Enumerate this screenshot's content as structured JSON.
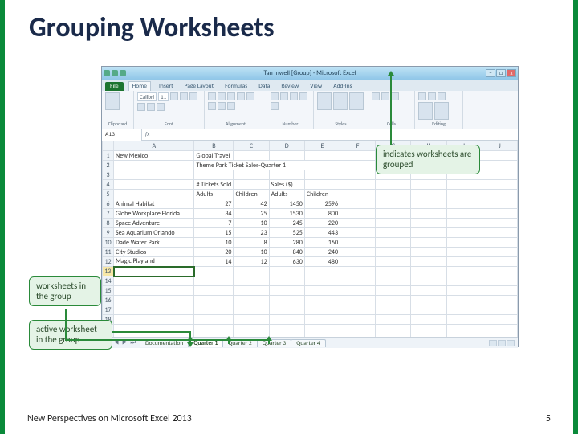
{
  "slide": {
    "title": "Grouping Worksheets",
    "footer_left": "New Perspectives on Microsoft Excel 2013",
    "footer_right": "5"
  },
  "callouts": {
    "grouped": "indicates worksheets are grouped",
    "in_group": "worksheets in the group",
    "active": "active worksheet in the group"
  },
  "excel": {
    "titlebar": "Tan Inwell [Group] - Microsoft Excel",
    "win_min": "–",
    "win_max": "□",
    "win_close": "x",
    "file_tab": "File",
    "tabs": [
      "Home",
      "Insert",
      "Page Layout",
      "Formulas",
      "Data",
      "Review",
      "View",
      "Add-Ins"
    ],
    "ribbon_groups": [
      "Clipboard",
      "Font",
      "Alignment",
      "Number",
      "Styles",
      "Cells",
      "Editing"
    ],
    "font_name": "Calibri",
    "font_size": "11",
    "name_box": "A13",
    "fx": "fx",
    "columns": [
      "A",
      "B",
      "C",
      "D",
      "E",
      "F",
      "G",
      "H",
      "I",
      "J"
    ],
    "a1": "New Mexico",
    "b1": "Global Travel",
    "b2": "Theme Park Ticket Sales-Quarter 1",
    "b4": "# Tickets Sold",
    "d4": "Sales ($)",
    "b5": "Adults",
    "c5": "Children",
    "d5": "Adults",
    "e5": "Children",
    "sheet_nav": "⏮ ◀ ▶ ⏭",
    "sheets": [
      "Documentation",
      "Quarter 1",
      "Quarter 2",
      "Quarter 3",
      "Quarter 4"
    ],
    "rows": [
      {
        "label": "Animal Habitat",
        "b": "27",
        "c": "42",
        "d": "1450",
        "e": "2596"
      },
      {
        "label": "Globe Workplace Florida",
        "b": "34",
        "c": "25",
        "d": "1530",
        "e": "800"
      },
      {
        "label": "Space Adventure",
        "b": "7",
        "c": "10",
        "d": "245",
        "e": "220"
      },
      {
        "label": "Sea Aquarium Orlando",
        "b": "15",
        "c": "23",
        "d": "525",
        "e": "443"
      },
      {
        "label": "Dade Water Park",
        "b": "10",
        "c": "8",
        "d": "280",
        "e": "160"
      },
      {
        "label": "City Studios",
        "b": "20",
        "c": "10",
        "d": "840",
        "e": "240"
      },
      {
        "label": "Magic Playland",
        "b": "14",
        "c": "12",
        "d": "630",
        "e": "480"
      }
    ]
  }
}
